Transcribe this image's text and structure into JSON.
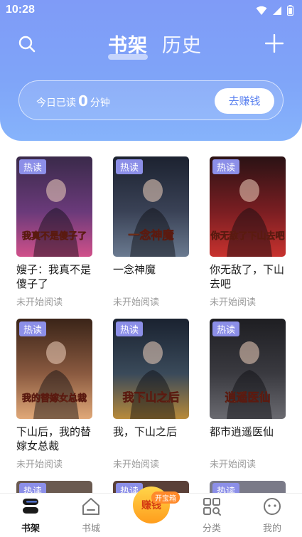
{
  "status_bar": {
    "time": "10:28"
  },
  "header": {
    "tabs": [
      {
        "label": "书架",
        "active": true
      },
      {
        "label": "历史",
        "active": false
      }
    ]
  },
  "reading_banner": {
    "prefix": "今日已读",
    "minutes": "0",
    "suffix": "分钟",
    "earn_button": "去赚钱"
  },
  "books": [
    {
      "tag": "热读",
      "title": "嫂子：我真不是傻子了",
      "status": "未开始阅读",
      "cover_text": "我真不是傻子了",
      "cover_colors": [
        "#3a2a4a",
        "#6a3a7a",
        "#d0508a"
      ]
    },
    {
      "tag": "热读",
      "title": "一念神魔",
      "status": "未开始阅读",
      "cover_text": "一念神魔",
      "cover_colors": [
        "#1c2230",
        "#3a4256",
        "#6a7a90"
      ]
    },
    {
      "tag": "热读",
      "title": "你无敌了，下山去吧",
      "status": "未开始阅读",
      "cover_text": "你无敌了下山去吧",
      "cover_colors": [
        "#2a1214",
        "#7a1e22",
        "#c8322e"
      ]
    },
    {
      "tag": "热读",
      "title": "下山后，我的替嫁女总裁",
      "status": "未开始阅读",
      "cover_text": "我的替嫁女总裁",
      "cover_colors": [
        "#3a2418",
        "#8a5a40",
        "#e0a878"
      ]
    },
    {
      "tag": "热读",
      "title": "我，下山之后",
      "status": "未开始阅读",
      "cover_text": "我下山之后",
      "cover_colors": [
        "#1a2230",
        "#3a4a5a",
        "#b88a3a"
      ]
    },
    {
      "tag": "热读",
      "title": "都市逍遥医仙",
      "status": "未开始阅读",
      "cover_text": "逍遥医仙",
      "cover_colors": [
        "#1e1e22",
        "#3a3a40",
        "#6a6a70"
      ]
    }
  ],
  "peek_tags": [
    "热读",
    "热读",
    "热读"
  ],
  "bottom_nav": {
    "items": [
      {
        "label": "书架",
        "icon": "bookshelf-icon",
        "active": true
      },
      {
        "label": "书城",
        "icon": "bookstore-icon",
        "active": false
      },
      {
        "label": "分类",
        "icon": "category-icon",
        "active": false
      },
      {
        "label": "我的",
        "icon": "profile-icon",
        "active": false
      }
    ],
    "earn_label": "赚钱",
    "chest_badge": "开宝箱"
  },
  "colors": {
    "accent": "#5b82f0",
    "header_gradient_top": "#7f9bf7",
    "header_gradient_bottom": "#86b3fb",
    "hot_tag": "#8c8fe8"
  }
}
